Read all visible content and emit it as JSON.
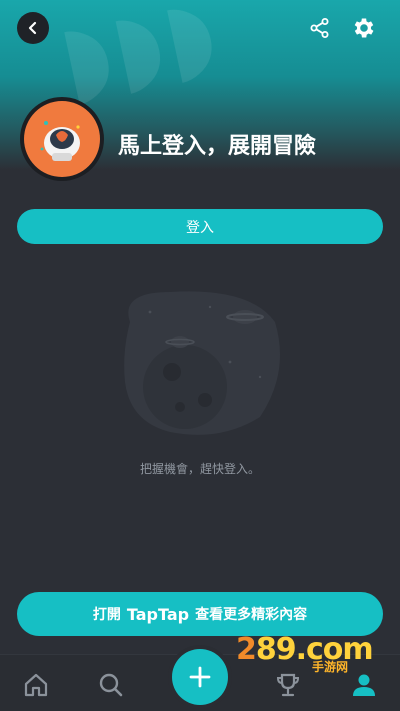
{
  "header": {
    "back_icon": "chevron-left-icon",
    "share_icon": "share-icon",
    "settings_icon": "gear-icon"
  },
  "profile": {
    "headline": "馬上登入，展開冒險"
  },
  "login_button": {
    "label": "登入"
  },
  "empty_state": {
    "illustration": "planet-illustration",
    "message": "把握機會，趕快登入。"
  },
  "open_app": {
    "prefix": "打開",
    "brand": "TapTap",
    "suffix": "查看更多精彩內容"
  },
  "tabbar": {
    "items": [
      {
        "icon": "home-icon",
        "active": false
      },
      {
        "icon": "search-icon",
        "active": false
      },
      {
        "icon": "plus-icon",
        "active": false
      },
      {
        "icon": "trophy-icon",
        "active": false
      },
      {
        "icon": "user-icon",
        "active": true
      }
    ]
  },
  "watermark": {
    "main_part1": "2",
    "main_part2": "89.com",
    "sub": "手游网"
  },
  "colors": {
    "accent": "#16bfc4",
    "background": "#2c2f36",
    "avatar_bg": "#f07a3e"
  }
}
